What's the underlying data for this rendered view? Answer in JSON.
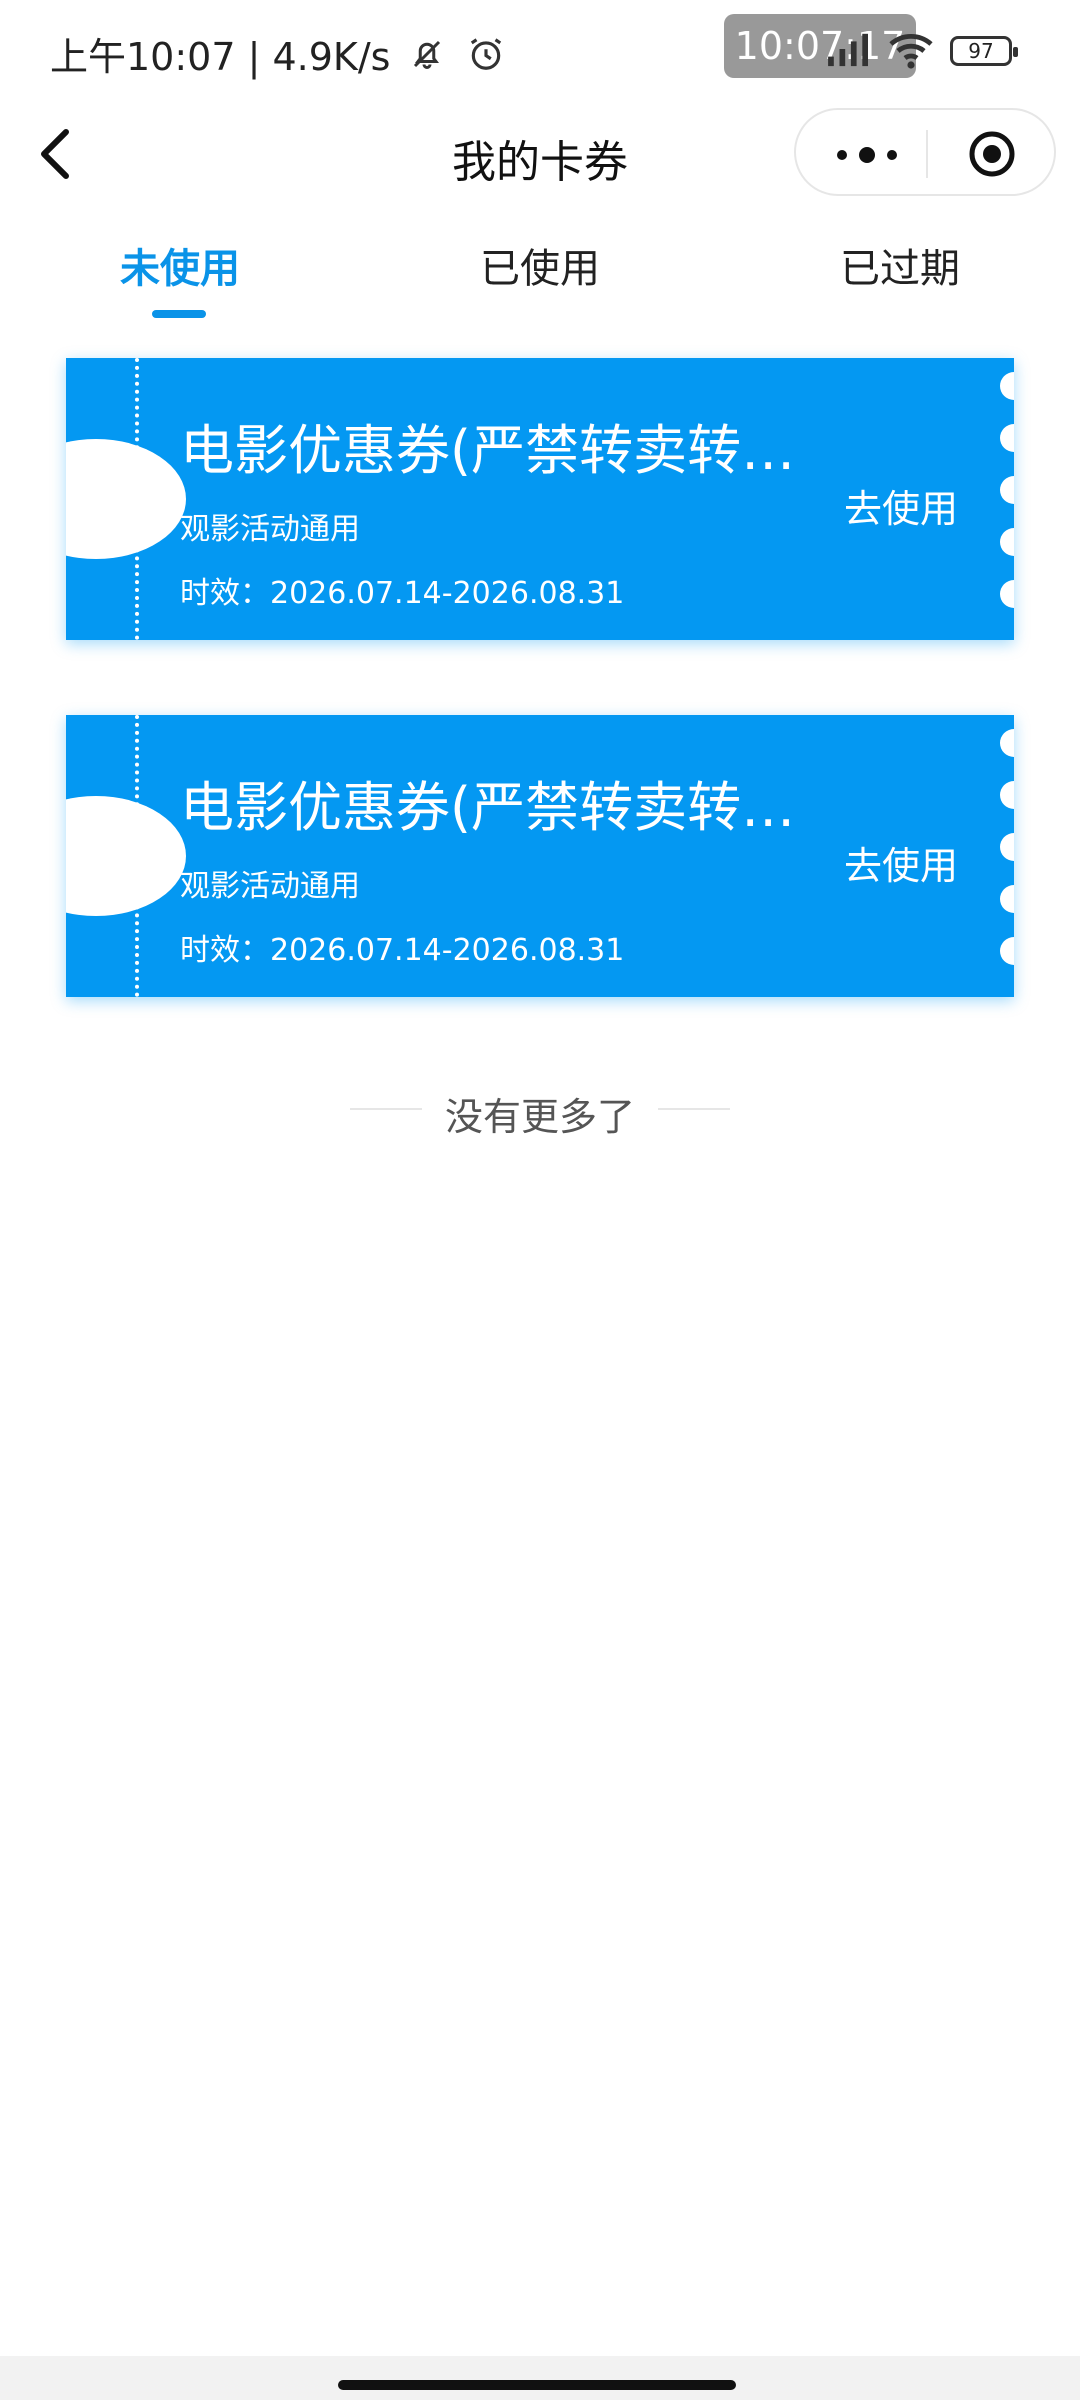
{
  "status": {
    "left_text": "上午10:07 | 4.9K/s",
    "time_overlay": "10:07:17",
    "battery": "97"
  },
  "nav": {
    "title": "我的卡券"
  },
  "tabs": [
    {
      "label": "未使用",
      "active": true
    },
    {
      "label": "已使用",
      "active": false
    },
    {
      "label": "已过期",
      "active": false
    }
  ],
  "coupons": [
    {
      "title": "电影优惠券(严禁转卖转…",
      "subtitle": "观影活动通用",
      "validity": "时效：2026.07.14-2026.08.31",
      "action": "去使用"
    },
    {
      "title": "电影优惠券(严禁转卖转…",
      "subtitle": "观影活动通用",
      "validity": "时效：2026.07.14-2026.08.31",
      "action": "去使用"
    }
  ],
  "footer": {
    "no_more": "没有更多了"
  },
  "colors": {
    "accent": "#0a93e8",
    "coupon_bg": "#0498f2"
  },
  "icons": [
    "bell-off-icon",
    "alarm-icon",
    "signal-icon",
    "wifi-icon",
    "battery-icon",
    "back-icon",
    "more-icon",
    "close-circle-icon"
  ]
}
